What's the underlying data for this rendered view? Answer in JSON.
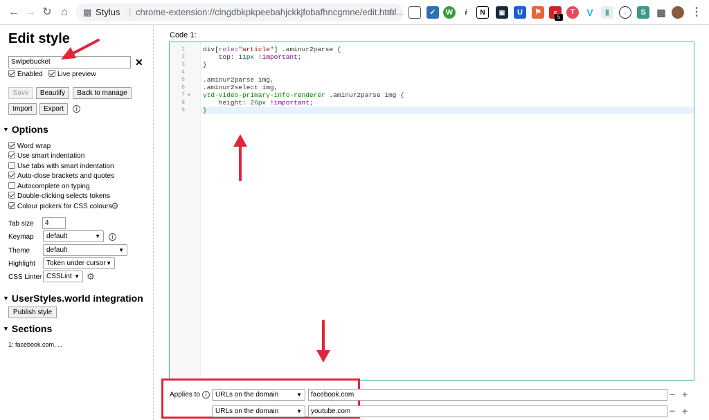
{
  "browser": {
    "origin": "Stylus",
    "url": "chrome-extension://clngdbkpkpeebahjckkjfobafhncgmne/edit.html...",
    "ext_badge": "5"
  },
  "sidebar": {
    "title": "Edit style",
    "style_name": "Swipebucket",
    "enabled_label": "Enabled",
    "live_preview_label": "Live preview",
    "save_label": "Save",
    "beautify_label": "Beautify",
    "back_label": "Back to manage",
    "import_label": "Import",
    "export_label": "Export",
    "options_heading": "Options",
    "options": [
      {
        "label": "Word wrap",
        "checked": true
      },
      {
        "label": "Use smart indentation",
        "checked": true
      },
      {
        "label": "Use tabs with smart indentation",
        "checked": false
      },
      {
        "label": "Auto-close brackets and quotes",
        "checked": true
      },
      {
        "label": "Autocomplete on typing",
        "checked": false
      },
      {
        "label": "Double-clicking selects tokens",
        "checked": true
      },
      {
        "label": "Colour pickers for CSS colours",
        "checked": true
      }
    ],
    "tab_size_label": "Tab size",
    "tab_size_value": "4",
    "keymap_label": "Keymap",
    "keymap_value": "default",
    "theme_label": "Theme",
    "theme_value": "default",
    "highlight_label": "Highlight",
    "highlight_value": "Token under cursor",
    "linter_label": "CSS Linter",
    "linter_value": "CSSLint",
    "usw_heading": "UserStyles.world integration",
    "publish_label": "Publish style",
    "sections_heading": "Sections",
    "sections_item": "1: facebook.com, ..."
  },
  "editor": {
    "code_label": "Code 1:",
    "line_numbers": [
      "1",
      "2",
      "3",
      "4",
      "5",
      "6",
      "7",
      "8",
      "9"
    ]
  },
  "applies": {
    "label": "Applies to",
    "rows": [
      {
        "type": "URLs on the domain",
        "value": "facebook.com"
      },
      {
        "type": "URLs on the domain",
        "value": "youtube.com"
      }
    ]
  },
  "colors": {
    "accent": "#3fb8af",
    "annotation": "#e0263c"
  }
}
